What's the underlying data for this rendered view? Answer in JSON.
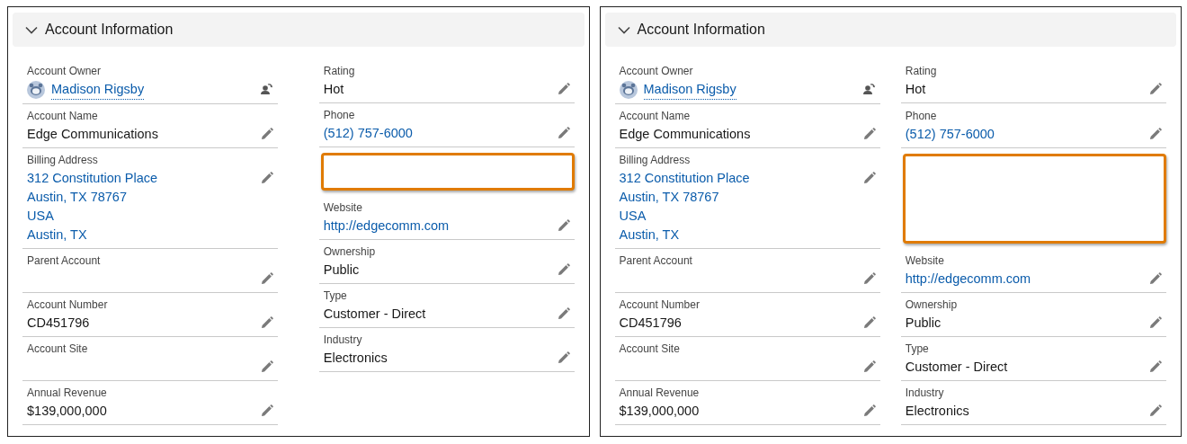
{
  "panels": [
    {
      "title": "Account Information",
      "expanded": true,
      "aligned_rows": false,
      "columns": [
        [
          {
            "kind": "user",
            "label": "Account Owner",
            "value": "Madison Rigsby"
          },
          {
            "kind": "text",
            "label": "Account Name",
            "value": "Edge Communications"
          },
          {
            "kind": "link",
            "label": "Billing Address",
            "lines": [
              "312 Constitution Place",
              "Austin, TX 78767",
              "USA",
              "Austin, TX"
            ]
          },
          {
            "kind": "text",
            "label": "Parent Account"
          },
          {
            "kind": "text",
            "label": "Account Number",
            "value": "CD451796"
          },
          {
            "kind": "text",
            "label": "Account Site"
          },
          {
            "kind": "text",
            "label": "Annual Revenue",
            "value": "$139,000,000"
          }
        ],
        [
          {
            "kind": "text",
            "label": "Rating",
            "value": "Hot"
          },
          {
            "kind": "link",
            "label": "Phone",
            "value": "(512) 757-6000"
          },
          {
            "kind": "highlight"
          },
          {
            "kind": "link",
            "label": "Website",
            "value": "http://edgecomm.com"
          },
          {
            "kind": "text",
            "label": "Ownership",
            "value": "Public"
          },
          {
            "kind": "text",
            "label": "Type",
            "value": "Customer - Direct"
          },
          {
            "kind": "text",
            "label": "Industry",
            "value": "Electronics"
          }
        ]
      ]
    },
    {
      "title": "Account Information",
      "expanded": true,
      "aligned_rows": true,
      "columns": [
        [
          {
            "kind": "user",
            "label": "Account Owner",
            "value": "Madison Rigsby"
          },
          {
            "kind": "text",
            "label": "Account Name",
            "value": "Edge Communications"
          },
          {
            "kind": "link",
            "label": "Billing Address",
            "lines": [
              "312 Constitution Place",
              "Austin, TX 78767",
              "USA",
              "Austin, TX"
            ]
          },
          {
            "kind": "text",
            "label": "Parent Account"
          },
          {
            "kind": "text",
            "label": "Account Number",
            "value": "CD451796"
          },
          {
            "kind": "text",
            "label": "Account Site"
          },
          {
            "kind": "text",
            "label": "Annual Revenue",
            "value": "$139,000,000"
          }
        ],
        [
          {
            "kind": "text",
            "label": "Rating",
            "value": "Hot"
          },
          {
            "kind": "link",
            "label": "Phone",
            "value": "(512) 757-6000"
          },
          {
            "kind": "highlight"
          },
          {
            "kind": "link",
            "label": "Website",
            "value": "http://edgecomm.com"
          },
          {
            "kind": "text",
            "label": "Ownership",
            "value": "Public"
          },
          {
            "kind": "text",
            "label": "Type",
            "value": "Customer - Direct"
          },
          {
            "kind": "text",
            "label": "Industry",
            "value": "Electronics"
          }
        ]
      ]
    }
  ]
}
